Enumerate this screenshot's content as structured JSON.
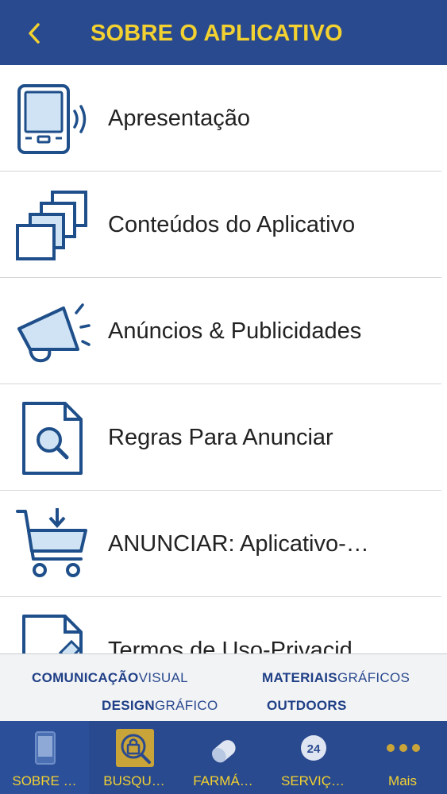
{
  "header": {
    "title": "SOBRE O APLICATIVO",
    "back_icon": "chevron-left-icon"
  },
  "colors": {
    "brand": "#2a4a8f",
    "accent": "#f2d130",
    "icon_stroke": "#1f4f8a",
    "icon_fill": "#cfe3f5"
  },
  "menu": {
    "items": [
      {
        "label": "Apresentação",
        "icon": "tablet-sound-icon"
      },
      {
        "label": "Conteúdos do Aplicativo",
        "icon": "stacked-pages-icon"
      },
      {
        "label": "Anúncios & Publicidades",
        "icon": "megaphone-icon"
      },
      {
        "label": "Regras Para Anunciar",
        "icon": "document-search-icon"
      },
      {
        "label": "ANUNCIAR: Aplicativo-…",
        "icon": "cart-download-icon"
      },
      {
        "label": "Termos de Uso-Privacid",
        "icon": "document-icon"
      }
    ]
  },
  "banner": {
    "line1a_strong": "COMUNICAÇÃO",
    "line1a_light": "VISUAL",
    "line1b_strong": "MATERIAIS",
    "line1b_light": "GRÁFICOS",
    "line2a_strong": "DESIGN",
    "line2a_light": "GRÁFICO",
    "line2b_strong": "OUTDOORS"
  },
  "tabbar": {
    "tabs": [
      {
        "label": "SOBRE …",
        "icon": "tablet-icon",
        "active": true
      },
      {
        "label": "BUSQU…",
        "icon": "search-lock-icon",
        "active": false
      },
      {
        "label": "FARMÁ…",
        "icon": "pill-icon",
        "active": false
      },
      {
        "label": "SERVIÇ…",
        "icon": "24h-icon",
        "active": false
      },
      {
        "label": "Mais",
        "icon": "more-dots-icon",
        "active": false
      }
    ],
    "service_badge": "24"
  }
}
